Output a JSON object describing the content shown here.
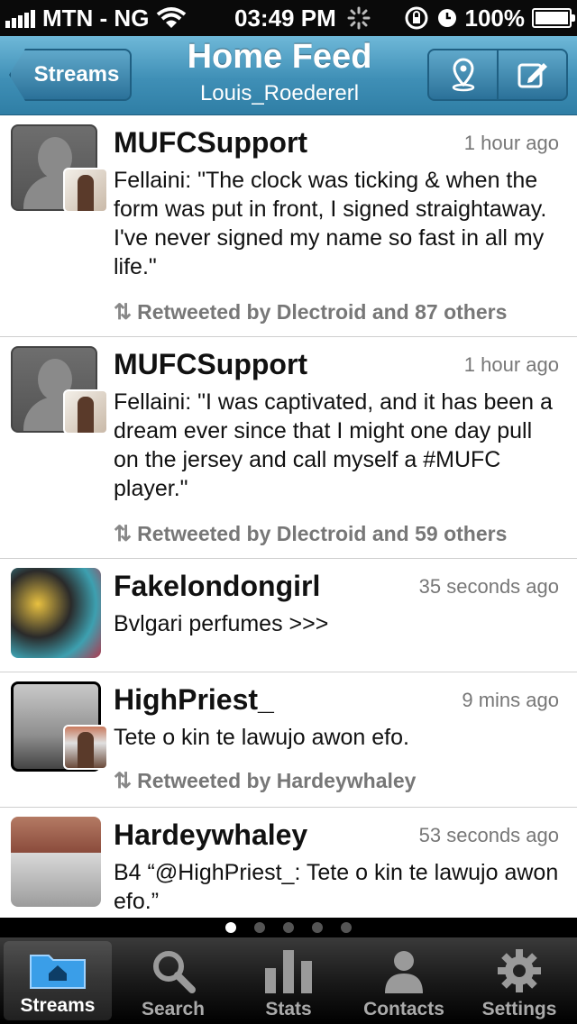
{
  "status_bar": {
    "carrier": "MTN - NG",
    "time": "03:49 PM",
    "battery": "100%",
    "battery_level": 1.0
  },
  "nav": {
    "back_label": "Streams",
    "title": "Home Feed",
    "subtitle": "Louis_Roedererl",
    "buttons": [
      "location-pin-icon",
      "compose-icon"
    ]
  },
  "tweets": [
    {
      "name": "MUFCSupport",
      "time": "1 hour ago",
      "text": "Fellaini: \"The clock was ticking & when the form was put in front, I signed straightaway. I've never signed my name so fast in all my life.\"",
      "retweet": "Retweeted by Dlectroid and 87 others"
    },
    {
      "name": "MUFCSupport",
      "time": "1 hour ago",
      "text": "Fellaini: \"I was captivated, and it has been a dream ever since that I might one day pull on the jersey and call myself a #MUFC player.\"",
      "retweet": "Retweeted by Dlectroid and 59 others"
    },
    {
      "name": "Fakelondongirl",
      "time": "35 seconds ago",
      "text": "Bvlgari perfumes >>>",
      "retweet": ""
    },
    {
      "name": "HighPriest_",
      "time": "9 mins ago",
      "text": "Tete o kin te lawujo awon efo.",
      "retweet": "Retweeted by Hardeywhaley"
    },
    {
      "name": "Hardeywhaley",
      "time": "53 seconds ago",
      "text": "B4 “@HighPriest_: Tete o kin te lawujo awon efo.”",
      "retweet": ""
    }
  ],
  "page_dots": {
    "count": 5,
    "active": 0
  },
  "tabs": [
    {
      "label": "Streams",
      "icon": "home-folder-icon",
      "active": true
    },
    {
      "label": "Search",
      "icon": "search-icon",
      "active": false
    },
    {
      "label": "Stats",
      "icon": "stats-icon",
      "active": false
    },
    {
      "label": "Contacts",
      "icon": "contacts-icon",
      "active": false
    },
    {
      "label": "Settings",
      "icon": "gear-icon",
      "active": false
    }
  ],
  "colors": {
    "nav_blue": "#3f8fb6",
    "text_gray": "#777777"
  }
}
